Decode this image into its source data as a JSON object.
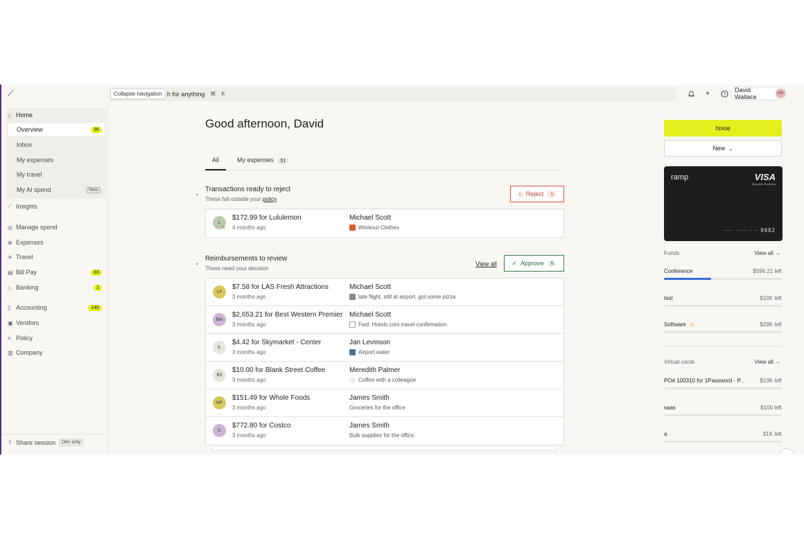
{
  "topbar": {
    "tooltip": "Collapse navigation",
    "search_visible": "h for anything",
    "kbd_cmd": "⌘",
    "kbd_k": "K",
    "user_name": "David Wallace",
    "user_initials": "DW"
  },
  "sidebar": {
    "home": "Home",
    "sub_items": [
      {
        "label": "Overview",
        "badge": "96"
      },
      {
        "label": "Inbox"
      },
      {
        "label": "My expenses"
      },
      {
        "label": "My travel"
      },
      {
        "label": "My AI spend",
        "badge": "New"
      }
    ],
    "insights": "Insights",
    "manage_spend": "Manage spend",
    "expenses": "Expenses",
    "travel": "Travel",
    "bill_pay": {
      "label": "Bill Pay",
      "badge": "83"
    },
    "banking": {
      "label": "Banking",
      "badge": "1"
    },
    "accounting": {
      "label": "Accounting",
      "badge": "145"
    },
    "vendors": "Vendors",
    "policy": "Policy",
    "company": "Company",
    "share_session": "Share session",
    "dev_only": "Dev only"
  },
  "main": {
    "greeting": "Good afternoon, David",
    "tabs": [
      {
        "label": "All"
      },
      {
        "label": "My expenses",
        "count": "51"
      }
    ],
    "reject_section": {
      "title": "Transactions ready to reject",
      "subtitle_prefix": "These fall outside your ",
      "subtitle_link": "policy",
      "button": "Reject",
      "count": "1",
      "rows": [
        {
          "initials": "L",
          "title": "$172.99 for Lululemon",
          "time": "4 months ago",
          "name": "Michael Scott",
          "memo": "Workout Clothes"
        }
      ]
    },
    "review_section": {
      "title": "Reimbursements to review",
      "subtitle": "These need your decision",
      "view_all": "View all",
      "button": "Approve",
      "count": "6",
      "rows": [
        {
          "initials": "LF",
          "title": "$7.58 for LAS Fresh Attractions",
          "time": "3 months ago",
          "name": "Michael Scott",
          "memo": "late flight, still at airport. got some pizza"
        },
        {
          "initials": "BW",
          "title": "$2,653.21 for Best Western Premier ...",
          "time": "3 months ago",
          "name": "Michael Scott",
          "memo": "Fwd: Hotels.com travel confirmation"
        },
        {
          "initials": "S-",
          "title": "$4.42 for Skymarket - Center",
          "time": "3 months ago",
          "name": "Jan Levinson",
          "memo": "Airport water"
        },
        {
          "initials": "BS",
          "title": "$10.00 for Blank Street Coffee",
          "time": "3 months ago",
          "name": "Meredith Palmer",
          "memo": "Coffee with a colleague"
        },
        {
          "initials": "WF",
          "title": "$151.49 for Whole Foods",
          "time": "3 months ago",
          "name": "James Smith",
          "memo": "Groceries for the office"
        },
        {
          "initials": "C",
          "title": "$772.80 for Costco",
          "time": "3 months ago",
          "name": "James Smith",
          "memo": "Bulk supplies for the office"
        }
      ]
    }
  },
  "right": {
    "issue": "Issue",
    "new": "New",
    "card": {
      "brand": "ramp",
      "network": "VISA",
      "network_sub": "Signature Business",
      "number": "···· ···· ···· 9682"
    },
    "funds_label": "Funds",
    "funds_view_all": "View all →",
    "funds": [
      {
        "name": "Conference",
        "amount": "$599.21 left",
        "used_fraction": 0.4
      },
      {
        "name": "test",
        "amount": "$10K left",
        "used_fraction": 0
      },
      {
        "name": "Software",
        "amount": "$20K left",
        "used_fraction": 0,
        "warning": "⚠"
      }
    ],
    "vcards_label": "Virtual cards",
    "vcards_view_all": "View all →",
    "vcards": [
      {
        "name": "PO# 100310 for 1Password · P...",
        "amount": "$10K left"
      },
      {
        "name": "saas",
        "amount": "$100 left"
      },
      {
        "name": "a",
        "amount": "$1K left"
      }
    ]
  },
  "colors": {
    "accent": "#e4f01d",
    "reject": "#d9543a",
    "approve": "#3c7d4d",
    "progress": "#3b6bd6"
  }
}
